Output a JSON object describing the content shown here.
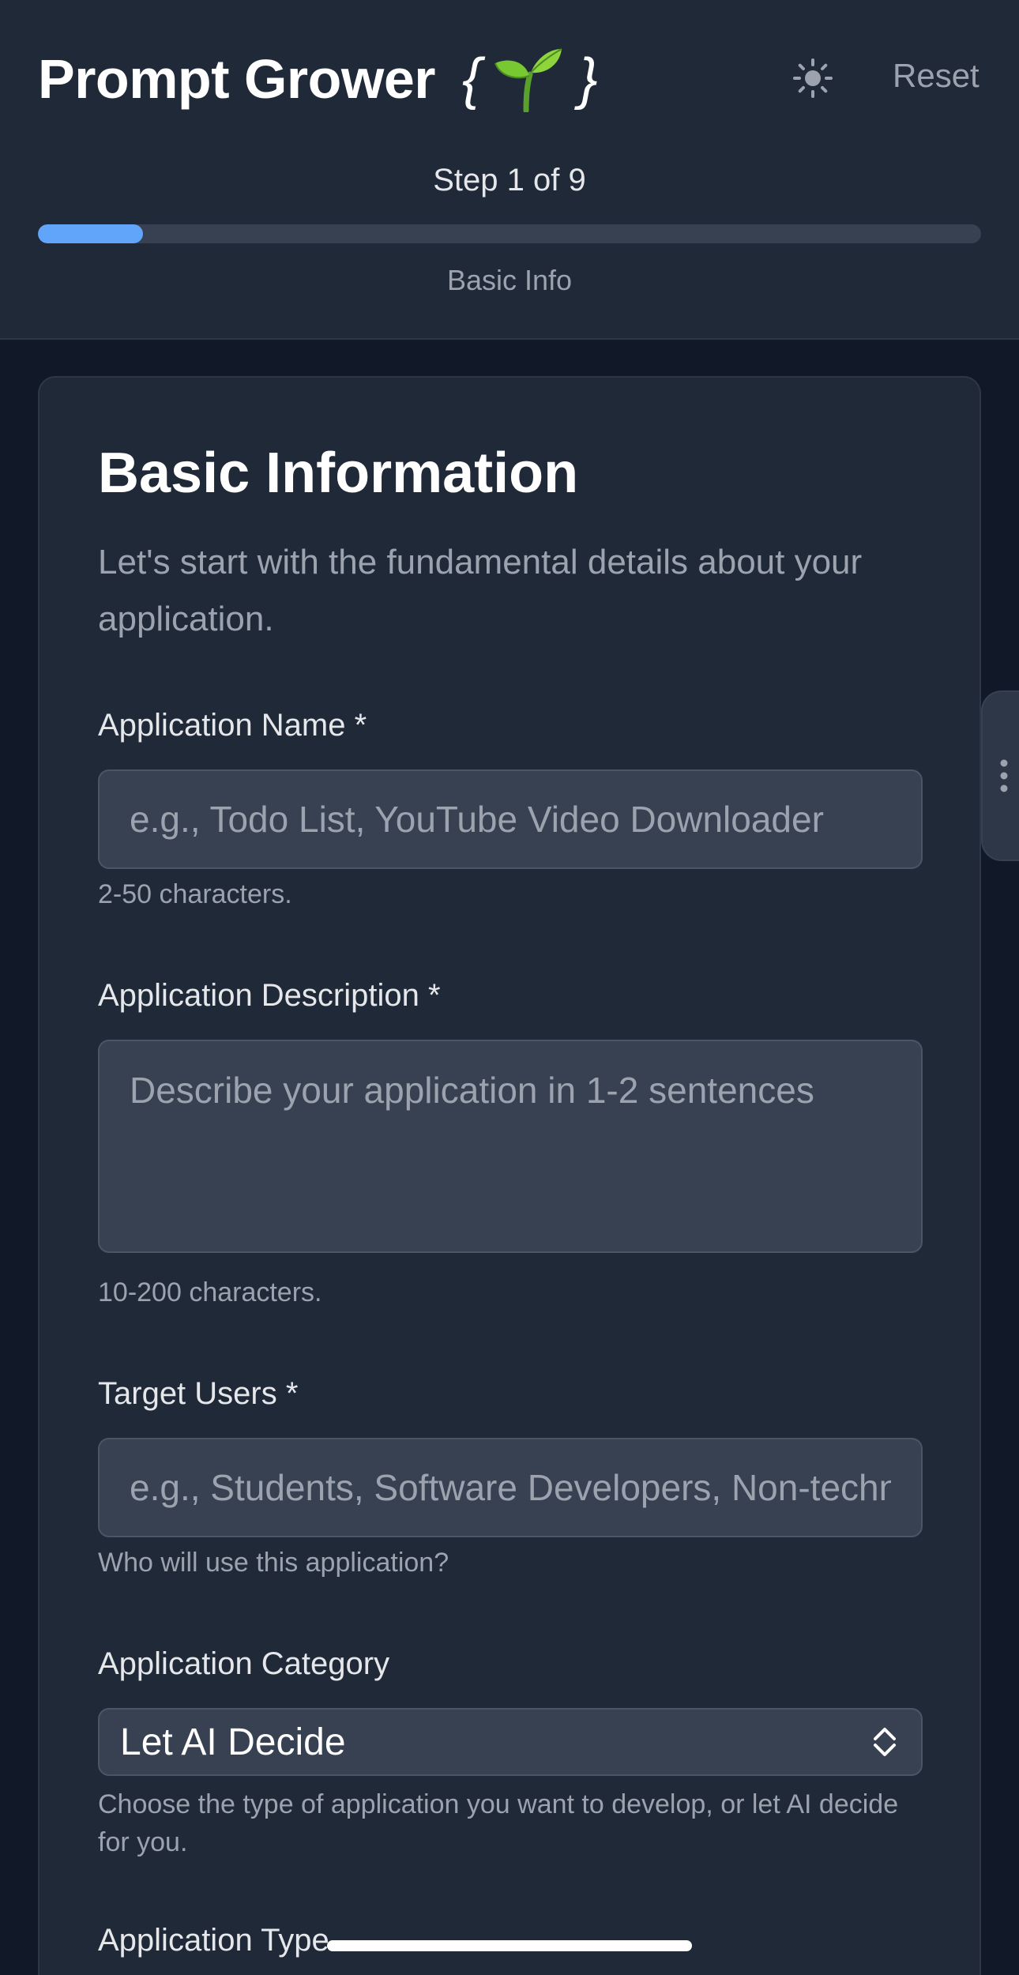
{
  "header": {
    "title": "Prompt Grower",
    "brace_open": "{",
    "brace_close": "}",
    "logo_icon": "sprout-emoji",
    "theme_icon": "sun-icon",
    "reset_label": "Reset",
    "step_text": "Step 1 of 9",
    "progress": {
      "current_step": 1,
      "total_steps": 9
    },
    "step_label": "Basic Info",
    "accent_color": "#60a5fa"
  },
  "card": {
    "title": "Basic Information",
    "subtitle": "Let's start with the fundamental details about your application.",
    "fields": {
      "app_name": {
        "label": "Application Name *",
        "placeholder": "e.g., Todo List, YouTube Video Downloader",
        "value": "",
        "help": "2-50 characters."
      },
      "app_description": {
        "label": "Application Description *",
        "placeholder": "Describe your application in 1-2 sentences",
        "value": "",
        "help": "10-200 characters."
      },
      "target_users": {
        "label": "Target Users *",
        "placeholder": "e.g., Students, Software Developers, Non-technical users",
        "value": "",
        "help": "Who will use this application?"
      },
      "app_category": {
        "label": "Application Category",
        "selected": "Let AI Decide",
        "help": "Choose the type of application you want to develop, or let AI decide for you."
      },
      "app_type": {
        "label": "Application Type"
      }
    }
  },
  "side_handle": {
    "icon": "vertical-dots-icon"
  }
}
